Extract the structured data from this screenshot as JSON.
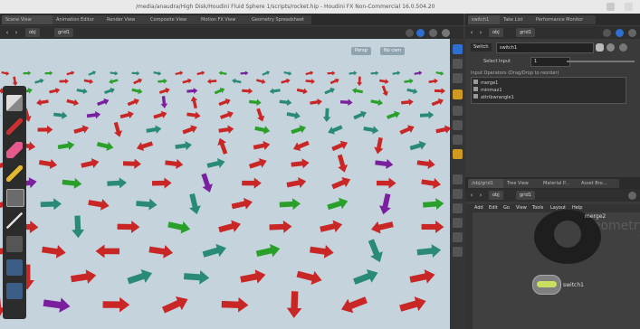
{
  "window": {
    "title": "/media/anaudra/High Disk/Houdini Fluid Sphere 1/scripts/rocket.hip - Houdini FX Non-Commercial 16.0.504.20"
  },
  "left_tabs": [
    {
      "label": "Scene View"
    },
    {
      "label": "Animation Editor"
    },
    {
      "label": "Render View"
    },
    {
      "label": "Composite View"
    },
    {
      "label": "Motion FX View"
    },
    {
      "label": "Geometry Spreadsheet"
    }
  ],
  "right_tabs": [
    {
      "label": "switch1"
    },
    {
      "label": "Take List"
    },
    {
      "label": "Performance Monitor"
    }
  ],
  "net_tabs": [
    {
      "label": "/obj/grid1"
    },
    {
      "label": "Tree View"
    },
    {
      "label": "Material P..."
    },
    {
      "label": "Asset Bro..."
    }
  ],
  "viewport_path": {
    "level1": "obj",
    "level2": "grid1"
  },
  "param_path": {
    "level1": "obj",
    "level2": "grid1"
  },
  "net_path": {
    "level1": "obj",
    "level2": "grid1"
  },
  "viewport": {
    "persp": "Persp",
    "cam": "No cam"
  },
  "params": {
    "node_type": "Switch",
    "node_name": "switch1",
    "select_label": "Select Input",
    "select_value": "1",
    "ops_label": "Input Operators (Drag/Drop to reorder)",
    "inputs": [
      "merge1",
      "minmax1",
      "attribwrangle1"
    ]
  },
  "net_menu": [
    "Add",
    "Edit",
    "Go",
    "View",
    "Tools",
    "Layout",
    "Help"
  ],
  "net_nodes": {
    "merge": "merge2",
    "watermark": "Geometry",
    "switch": "switch1"
  },
  "colors": {
    "red": "#c92626",
    "purple": "#7a1f9e",
    "teal": "#2a8a78",
    "green": "#2aa02a",
    "yellow": "#c8d020",
    "blue": "#2a5fc8",
    "viewport_bg": "#c4d3dc"
  },
  "icons": [
    "back-icon",
    "forward-icon",
    "obj-icon",
    "gear-icon",
    "help-icon",
    "pin-icon",
    "toolbar-select-icon"
  ]
}
